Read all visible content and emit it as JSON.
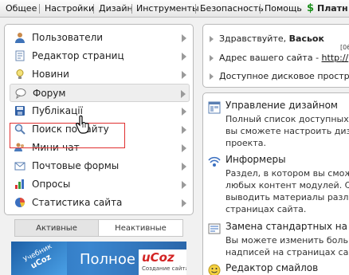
{
  "topbar": {
    "menu": [
      "Общее",
      "Настройки",
      "Дизайн",
      "Инструменты",
      "Безопасность",
      "Помощь"
    ],
    "paid_icon": "$",
    "paid_label": "Платн"
  },
  "sidebar": {
    "items": [
      {
        "label": "Пользователи",
        "icon": "user-icon"
      },
      {
        "label": "Редактор страниц",
        "icon": "page-editor-icon"
      },
      {
        "label": "Новини",
        "icon": "lightbulb-icon"
      },
      {
        "label": "Форум",
        "icon": "forum-icon"
      },
      {
        "label": "Публікації",
        "icon": "publications-icon"
      },
      {
        "label": "Поиск по сайту",
        "icon": "search-icon"
      },
      {
        "label": "Мини-чат",
        "icon": "chat-icon"
      },
      {
        "label": "Почтовые формы",
        "icon": "mail-icon"
      },
      {
        "label": "Опросы",
        "icon": "poll-icon"
      },
      {
        "label": "Статистика сайта",
        "icon": "stats-icon"
      }
    ],
    "hovered_item": "Форум",
    "highlighted_item": "Публікації"
  },
  "tabs": {
    "active": "Активные",
    "inactive": "Неактивные"
  },
  "banner": {
    "tilt1": "Учебник",
    "tilt2": "uCoz",
    "full": "Полное",
    "logo": "uCoz",
    "logo_sub": "Создание сайта"
  },
  "greeting": {
    "hello": "Здравствуйте,",
    "user": "Васьок",
    "date": "[06.0",
    "address_label": "Адрес вашего сайта -",
    "address_link": "http://",
    "disk_label": "Доступное дисковое простр"
  },
  "sections": [
    {
      "title": "Управление дизайном",
      "desc": [
        "Полный список доступных",
        "вы сможете настроить диз",
        "проекта."
      ]
    },
    {
      "title": "Информеры",
      "desc": [
        "Раздел, в котором вы смож",
        "любых контент модулей. С",
        "выводить материалы разли",
        "страницах сайта."
      ]
    },
    {
      "title": "Замена стандартных на",
      "desc": [
        "Вы можете изменить боль",
        "надписей на страницах са"
      ]
    },
    {
      "title": "Редактор смайлов",
      "desc": []
    }
  ],
  "colors": {
    "highlight_box": "#e03030",
    "paid_icon": "#1a8f1a",
    "banner_blue": "#2a6fb8"
  }
}
